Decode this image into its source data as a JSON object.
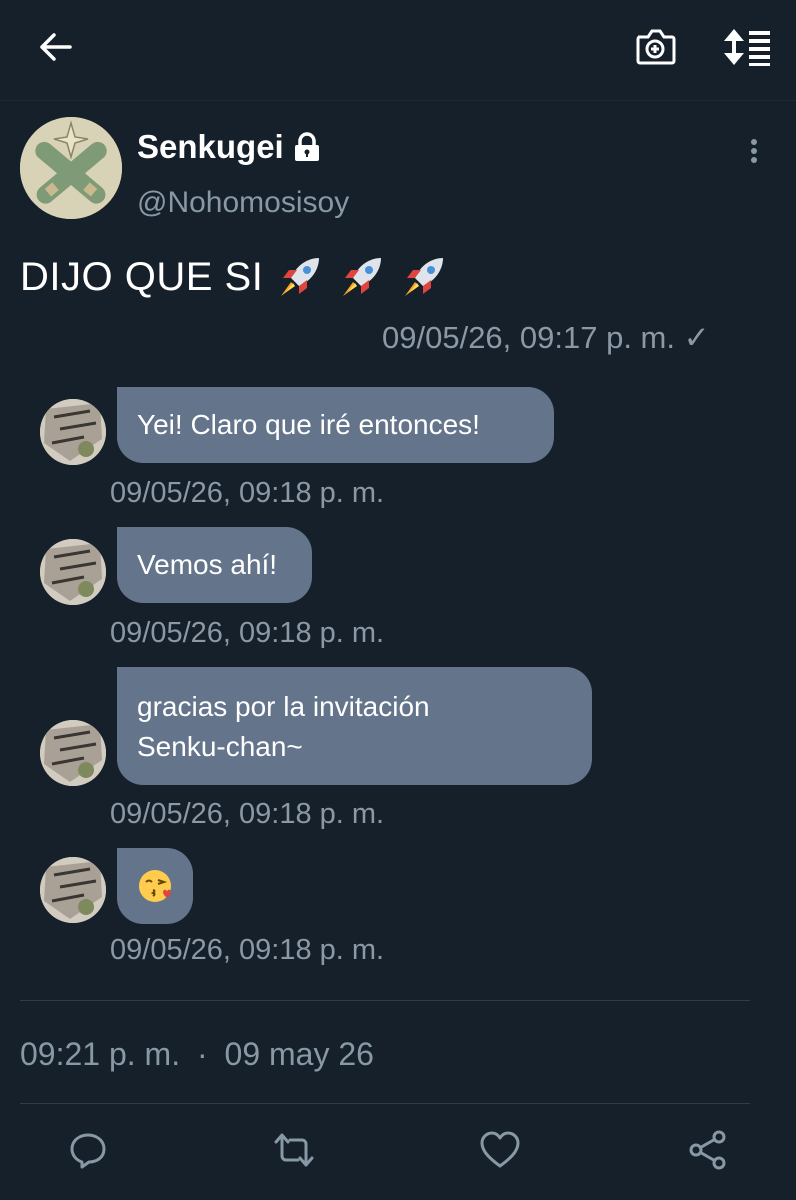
{
  "topbar": {
    "back_icon": "arrow-left-icon",
    "camera_icon": "camera-plus-icon",
    "sort_icon": "sort-lines-icon"
  },
  "author": {
    "display_name": "Senkugei",
    "lock_icon": "lock-icon",
    "handle": "@Nohomosisoy"
  },
  "tweet": {
    "text": "DIJO QUE SI",
    "emoji": [
      "🚀",
      "🚀",
      "🚀"
    ]
  },
  "chat": {
    "partial_timestamp": "09/05/26, 09:17 p. m. ✓",
    "messages": [
      {
        "text": "Yei! Claro que iré entonces!",
        "time": "09/05/26, 09:18 p. m."
      },
      {
        "text": "Vemos ahí!",
        "time": "09/05/26, 09:18 p. m."
      },
      {
        "line1": "gracias por la invitación",
        "line2": "Senku-chan~",
        "time": "09/05/26, 09:18 p. m."
      },
      {
        "text": "😘",
        "time": "09/05/26, 09:18 p. m."
      }
    ]
  },
  "meta": {
    "time": "09:21 p. m.",
    "separator": "·",
    "date": "09 may 26"
  },
  "actions": [
    "reply-icon",
    "retweet-icon",
    "like-icon",
    "share-icon"
  ],
  "colors": {
    "background": "#15202b",
    "bubble": "#64748b",
    "secondary_text": "#8899a6"
  }
}
